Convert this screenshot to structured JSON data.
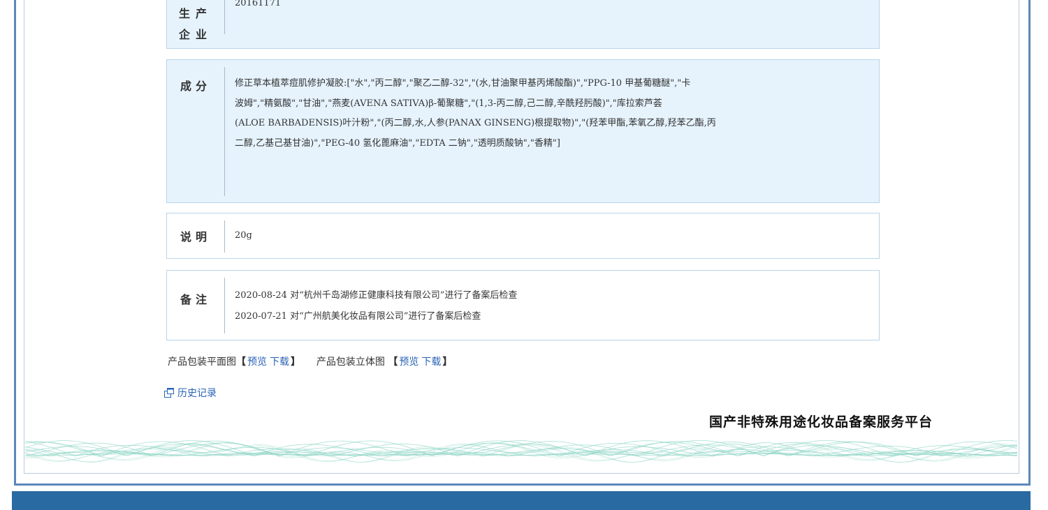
{
  "producer": {
    "label_line1": "生产",
    "label_line2": "企业",
    "value": "20161171"
  },
  "ingredients": {
    "label": "成分",
    "lines": [
      "修正草本植萃痘肌修护凝胶:[\"水\",\"丙二醇\",\"聚乙二醇-32\",\"(水,甘油聚甲基丙烯酸酯)\",\"PPG-10 甲基葡糖醚\",\"卡",
      "波姆\",\"精氨酸\",\"甘油\",\"燕麦(AVENA SATIVA)β-葡聚糖\",\"(1,3-丙二醇,己二醇,辛酰羟肟酸)\",\"库拉索芦荟",
      "(ALOE BARBADENSIS)叶汁粉\",\"(丙二醇,水,人参(PANAX GINSENG)根提取物)\",\"(羟苯甲酯,苯氧乙醇,羟苯乙酯,丙",
      "二醇,乙基己基甘油)\",\"PEG-40 氢化蓖麻油\",\"EDTA 二钠\",\"透明质酸钠\",\"香精\"]"
    ]
  },
  "description": {
    "label": "说明",
    "value": "20g"
  },
  "notes": {
    "label": "备注",
    "lines": [
      "2020-08-24 对“杭州千岛湖修正健康科技有限公司”进行了备案后检查",
      "2020-07-21 对“广州航美化妆品有限公司”进行了备案后检查"
    ]
  },
  "downloads": {
    "flat_label": "产品包装平面图",
    "solid_label": "产品包装立体图",
    "open_bracket": "【",
    "close_bracket": "】",
    "preview": "预览",
    "download": "下载"
  },
  "history": {
    "label": "历史记录",
    "icon": "popup-window-icon"
  },
  "platform_name": "国产非特殊用途化妆品备案服务平台",
  "colors": {
    "frame": "#5d87ba",
    "footer": "#2a6aa3",
    "panel_bg": "#e6f3fd",
    "link": "#2a63b4",
    "guilloche": "#8fd6c4"
  }
}
